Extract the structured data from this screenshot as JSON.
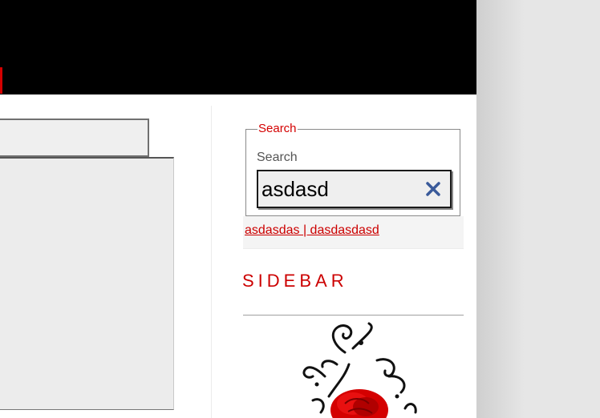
{
  "search": {
    "legend": "Search",
    "label": "Search",
    "value": "asdasd",
    "clear_icon": "close-icon"
  },
  "results": {
    "link_text": "asdasdas | dasdasdasd"
  },
  "sidebar": {
    "title": "SIDEBAR",
    "image": "rose-flourish-image"
  },
  "colors": {
    "accent": "#cc0000",
    "header": "#000000",
    "clear_icon": "#3a5a9a"
  }
}
